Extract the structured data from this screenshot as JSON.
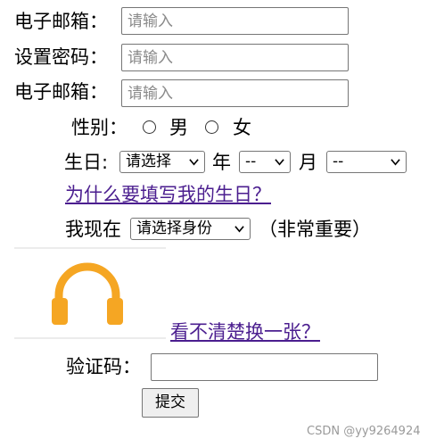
{
  "rows": {
    "email1": {
      "label": "电子邮箱：",
      "placeholder": "请输入",
      "value": ""
    },
    "password": {
      "label": "设置密码：",
      "placeholder": "请输入",
      "value": ""
    },
    "email2": {
      "label": "电子邮箱：",
      "placeholder": "请输入",
      "value": ""
    }
  },
  "gender": {
    "label": "性别：",
    "options": [
      "男",
      "女"
    ]
  },
  "birthday": {
    "label": "生日:",
    "year_select": "请选择",
    "year_unit": "年",
    "month_select": "--",
    "month_unit": "月",
    "day_select": "--"
  },
  "birthday_link": "为什么要填写我的生日？",
  "status": {
    "label": "我现在",
    "select": "请选择身份",
    "note": "（非常重要）"
  },
  "captcha": {
    "icon": "headphones-icon",
    "icon_color": "#f5a623",
    "refresh_link": "看不清楚换一张？"
  },
  "verify": {
    "label": "验证码：",
    "value": ""
  },
  "submit_label": "提交",
  "watermark": "CSDN @yy9264924"
}
